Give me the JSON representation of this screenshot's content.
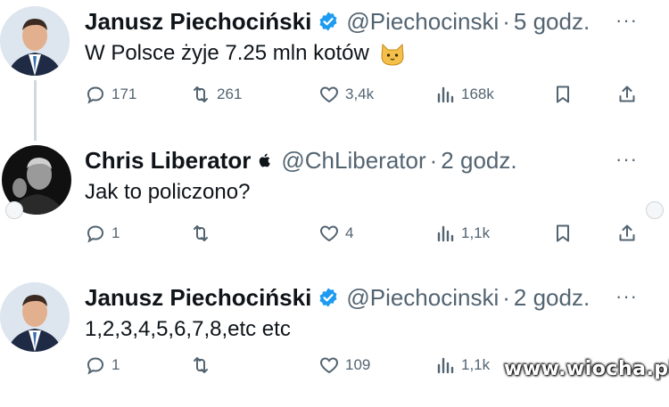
{
  "tweets": [
    {
      "name": "Janusz Piechociński",
      "handle": "@Piechocinski",
      "separator": "·",
      "time": "5 godz.",
      "text": "W Polsce żyje 7.25 mln kotów",
      "badge": "verified-badge",
      "emoji": "cat-face-icon",
      "replies": "171",
      "retweets": "261",
      "likes": "3,4k",
      "views": "168k"
    },
    {
      "name": "Chris Liberator",
      "handle": "@ChLiberator",
      "separator": "·",
      "time": "2 godz.",
      "text": "Jak to policzono?",
      "badge": "apple-icon",
      "replies": "1",
      "retweets": "",
      "likes": "4",
      "views": "1,1k"
    },
    {
      "name": "Janusz Piechociński",
      "handle": "@Piechocinski",
      "separator": "·",
      "time": "2 godz.",
      "text": "1,2,3,4,5,6,7,8,etc etc",
      "badge": "verified-badge",
      "replies": "1",
      "retweets": "",
      "likes": "109",
      "views": "1,1k"
    }
  ],
  "more_label": "···",
  "watermark": "www.wiocha.pl",
  "colors": {
    "text": "#0f1419",
    "muted": "#536471",
    "verified": "#1d9bf0",
    "connector": "#cfd9de"
  }
}
